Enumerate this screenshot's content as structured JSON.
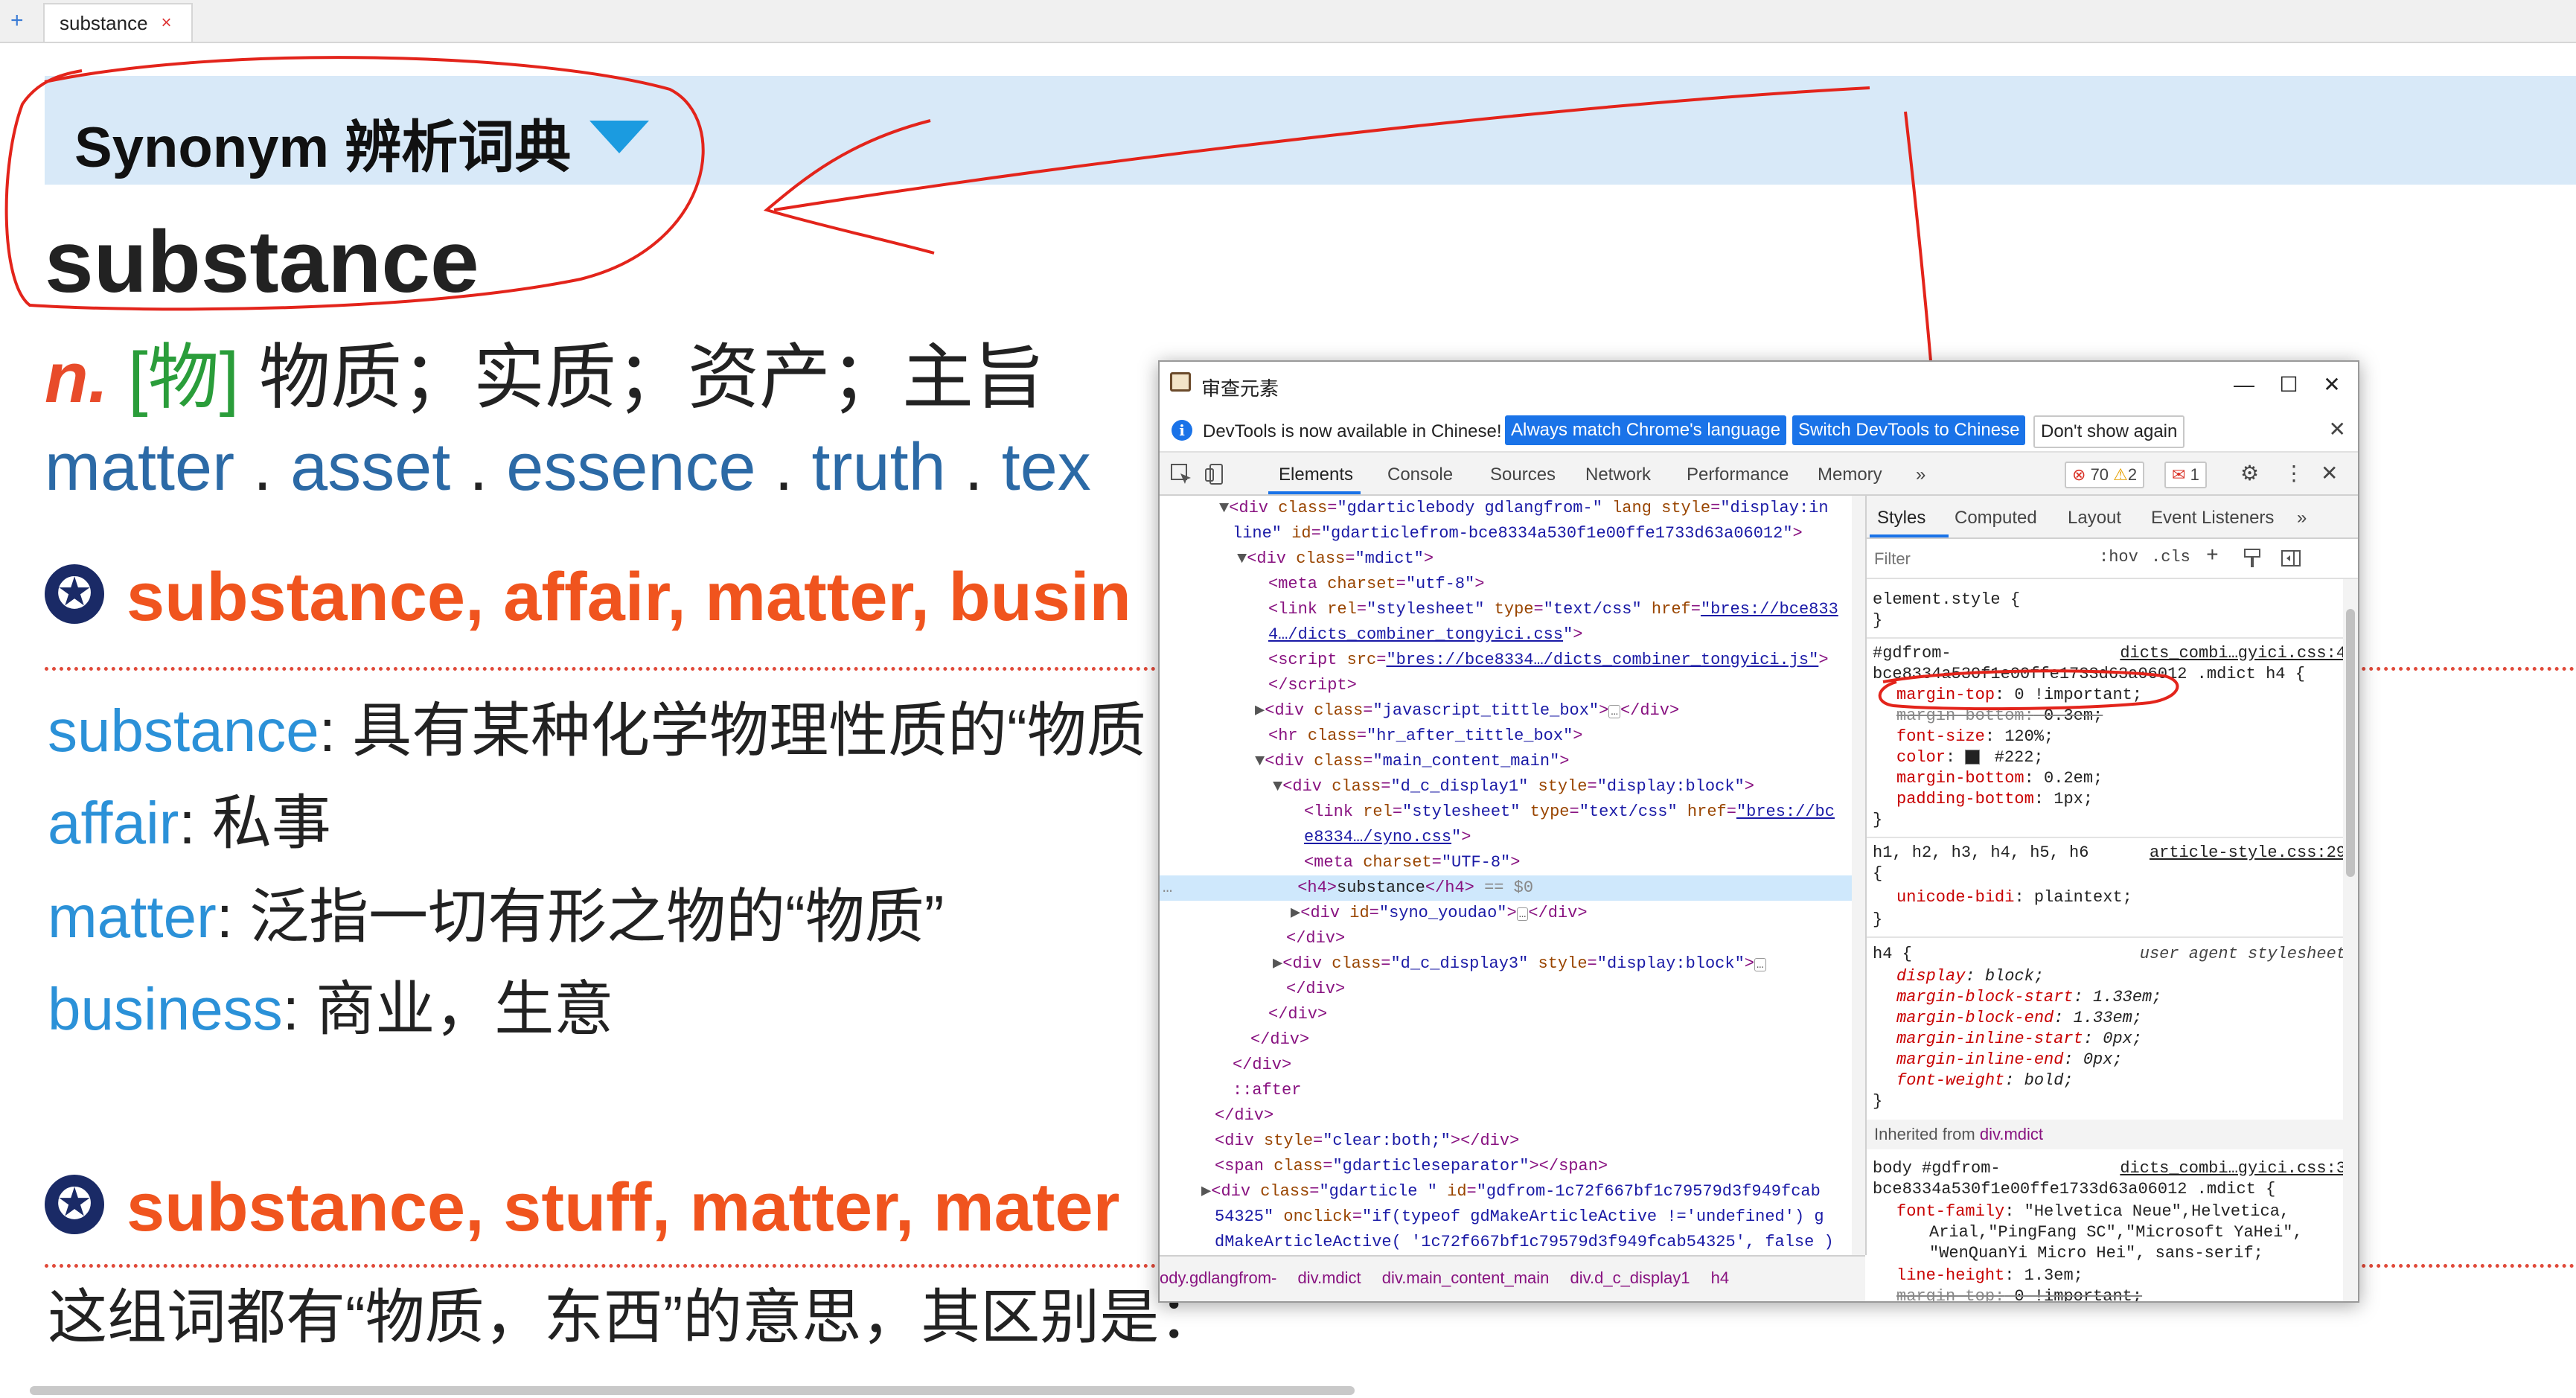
{
  "tab": {
    "label": "substance",
    "close": "×",
    "new": "+"
  },
  "dict": {
    "name": "Synonym 辨析词典",
    "headword": "substance",
    "pos": "n.",
    "field": "[物]",
    "meaning": "物质；实质；资产；主旨",
    "synonyms": [
      "matter",
      "asset",
      "essence",
      "truth",
      "tex"
    ],
    "sep": ".",
    "groups": [
      {
        "icon": "✪",
        "title": "substance, affair, matter, busin",
        "entries": [
          {
            "word": "substance",
            "def": ": 具有某种化学物理性质的“物质"
          },
          {
            "word": "affair",
            "def": ": 私事"
          },
          {
            "word": "matter",
            "def": ": 泛指一切有形之物的“物质”"
          },
          {
            "word": "business",
            "def": ": 商业，生意"
          }
        ]
      },
      {
        "icon": "✪",
        "title": "substance, stuff, matter, mater"
      }
    ],
    "sentence": "这组词都有“物质，东西”的意思，其区别是："
  },
  "devtools": {
    "title": "审查元素",
    "window": {
      "minimize": "—",
      "maximize": "☐",
      "close": "✕"
    },
    "infobar": {
      "icon": "i",
      "text": "DevTools is now available in Chinese!",
      "btn_match": "Always match Chrome's language",
      "btn_switch": "Switch DevTools to Chinese",
      "btn_dismiss": "Don't show again",
      "close": "✕"
    },
    "panels": {
      "tabs": [
        "Elements",
        "Console",
        "Sources",
        "Network",
        "Performance",
        "Memory"
      ],
      "more": "»",
      "errors": "70",
      "warnings": "2",
      "issues": "1",
      "settings": "⚙",
      "menu": "⋮",
      "close": "✕"
    },
    "elements": {
      "selected_marker": "== $0",
      "breadcrumb": [
        "ody.gdlangfrom-",
        "div.mdict",
        "div.main_content_main",
        "div.d_c_display1",
        "h4"
      ]
    },
    "styles": {
      "tabs": [
        "Styles",
        "Computed",
        "Layout",
        "Event Listeners"
      ],
      "more": "»",
      "filter_placeholder": "Filter",
      "hov": ":hov",
      "cls": ".cls",
      "add": "+",
      "rules": {
        "element_style": "element.style {",
        "close_brace": "}",
        "r1_selector_a": "#gdfrom-",
        "r1_selector_b": "bce8334a530f1e00ffe1733d63a06012 .mdict h4 {",
        "r1_source": "dicts_combi…gyici.css:4",
        "r1_props": [
          [
            "margin-top",
            " 0 !important;"
          ],
          [
            "margin-bottom",
            " 0.3em;"
          ],
          [
            "font-size",
            " 120%;"
          ],
          [
            "color",
            " #222;"
          ],
          [
            "margin-bottom",
            " 0.2em;"
          ],
          [
            "padding-bottom",
            " 1px;"
          ]
        ],
        "r2_selector": "h1, h2, h3, h4, h5, h6",
        "r2_source": "article-style.css:29",
        "r2_open": "{",
        "r2_prop": [
          "unicode-bidi",
          " plaintext;"
        ],
        "r3_selector": "h4 {",
        "r3_source": "user agent stylesheet",
        "r3_props": [
          [
            "display",
            " block;"
          ],
          [
            "margin-block-start",
            " 1.33em;"
          ],
          [
            "margin-block-end",
            " 1.33em;"
          ],
          [
            "margin-inline-start",
            " 0px;"
          ],
          [
            "margin-inline-end",
            " 0px;"
          ],
          [
            "font-weight",
            " bold;"
          ]
        ],
        "inherited_label": "Inherited from ",
        "inherited_from": "div.mdict",
        "r4_selector_a": "body #gdfrom-",
        "r4_selector_b": "bce8334a530f1e00ffe1733d63a06012 .mdict {",
        "r4_source": "dicts_combi…gyici.css:3",
        "r4_font_family": [
          "font-family",
          " \"Helvetica Neue\",Helvetica,"
        ],
        "r4_ff2": "Arial,\"PingFang SC\",\"Microsoft YaHei\",",
        "r4_ff3": "\"WenQuanYi Micro Hei\", sans-serif;",
        "r4_line_height": [
          "line-height",
          " 1.3em;"
        ],
        "r4_margin_top": [
          "margin-top",
          " 0 !important;"
        ]
      }
    }
  }
}
